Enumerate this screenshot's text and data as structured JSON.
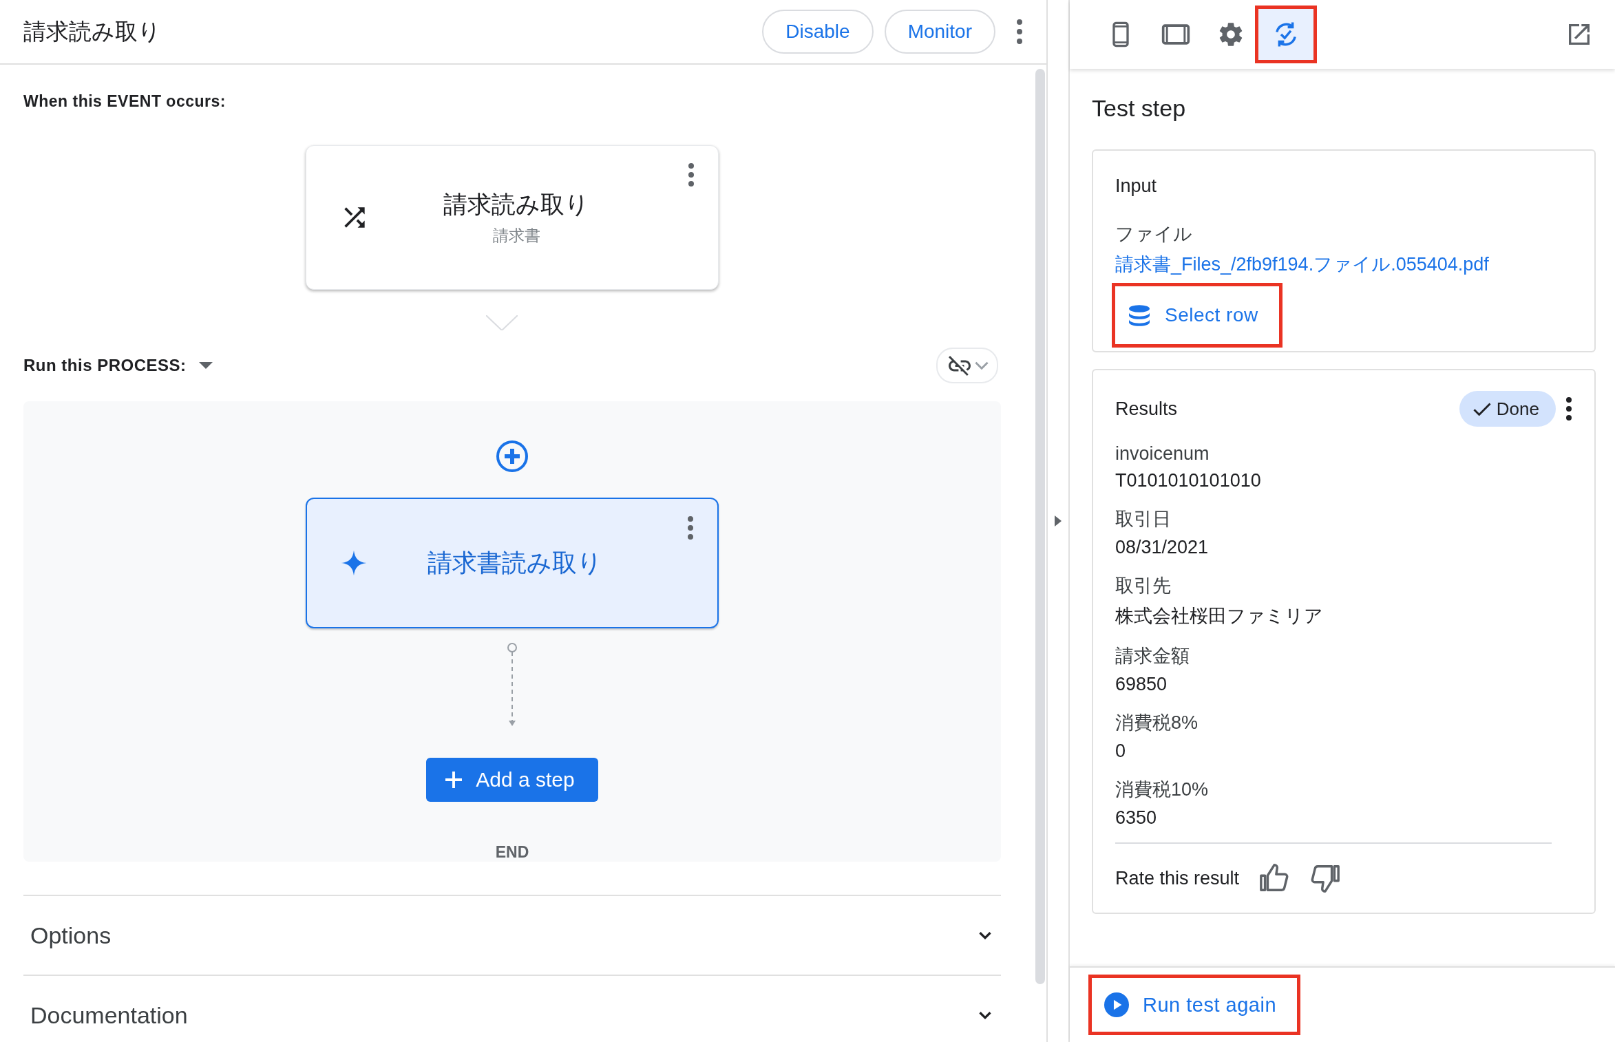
{
  "header": {
    "title": "請求読み取り",
    "buttons": [
      "Disable",
      "Monitor"
    ]
  },
  "event": {
    "label": "When this EVENT occurs:",
    "card": {
      "title": "請求読み取り",
      "subtitle": "請求書"
    }
  },
  "process": {
    "label": "Run this PROCESS:",
    "linked": false,
    "steps": [
      {
        "title": "請求書読み取り",
        "selected": true
      }
    ],
    "add_button": "Add a step",
    "end_label": "END"
  },
  "sections": [
    {
      "title": "Options",
      "expanded": false
    },
    {
      "title": "Documentation",
      "expanded": false
    }
  ],
  "toolbar": {
    "tools": [
      {
        "kind": "phone",
        "selected": false,
        "highlighted": false
      },
      {
        "kind": "tablet",
        "selected": false,
        "highlighted": false
      },
      {
        "kind": "settings",
        "selected": false,
        "highlighted": false
      },
      {
        "kind": "test",
        "selected": true,
        "highlighted": true
      }
    ]
  },
  "panel": {
    "title": "Test step"
  },
  "input": {
    "title": "Input",
    "field_label": "ファイル",
    "file_link": "請求書_Files_/2fb9f194.ファイル.055404.pdf",
    "select_button": {
      "label": "Select row",
      "highlighted": true
    }
  },
  "results": {
    "title": "Results",
    "status": "Done",
    "fields": [
      {
        "label": "invoicenum",
        "value": "T0101010101010"
      },
      {
        "label": "取引日",
        "value": "08/31/2021"
      },
      {
        "label": "取引先",
        "value": "株式会社桜田ファミリア"
      },
      {
        "label": "請求金額",
        "value": "69850"
      },
      {
        "label": "消費税8%",
        "value": "0"
      },
      {
        "label": "消費税10%",
        "value": "6350"
      }
    ],
    "rate_label": "Rate this result"
  },
  "run_button": {
    "label": "Run test again",
    "highlighted": true
  }
}
